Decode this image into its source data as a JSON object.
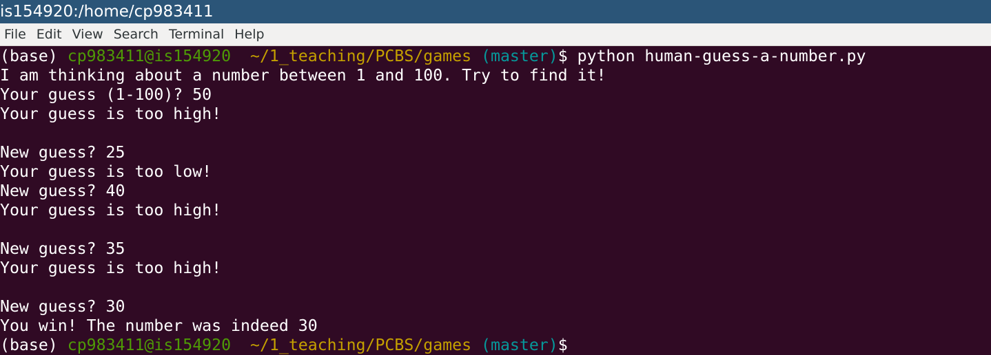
{
  "window": {
    "title": "is154920:/home/cp983411"
  },
  "menu": [
    "File",
    "Edit",
    "View",
    "Search",
    "Terminal",
    "Help"
  ],
  "prompt": {
    "env": "(base) ",
    "user_host": "cp983411@is154920",
    "path": "  ~/1_teaching/PCBS/games",
    "branch": " (master)",
    "symbol": "$"
  },
  "command": " python human-guess-a-number.py",
  "output": [
    "I am thinking about a number between 1 and 100. Try to find it!",
    "Your guess (1-100)? 50",
    "Your guess is too high!",
    "",
    "New guess? 25",
    "Your guess is too low!",
    "New guess? 40",
    "Your guess is too high!",
    "",
    "New guess? 35",
    "Your guess is too high!",
    "",
    "New guess? 30",
    "You win! The number was indeed 30"
  ],
  "colors": {
    "background": "#300a24",
    "user_host": "#4e9a06",
    "path": "#c4a000",
    "branch": "#06989a",
    "titlebar": "#2b5578"
  }
}
